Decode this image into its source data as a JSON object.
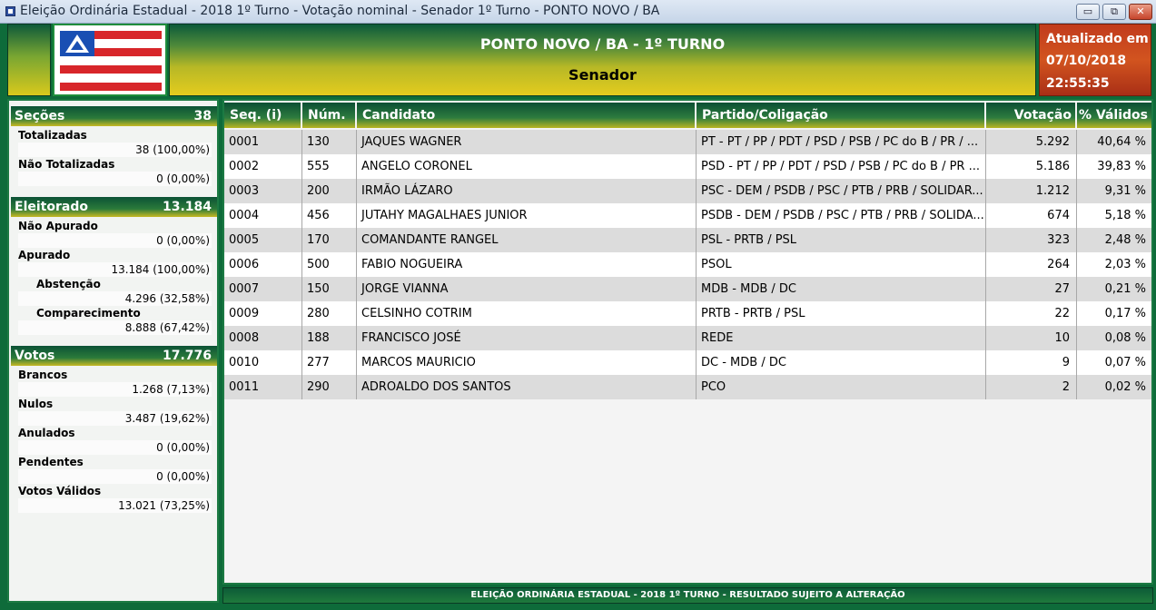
{
  "window": {
    "title": "Eleição Ordinária Estadual - 2018 1º Turno - Votação nominal - Senador 1º Turno - PONTO NOVO / BA",
    "minimize": "▭",
    "restore": "⧉",
    "close": "✕"
  },
  "header": {
    "location_round": "PONTO NOVO / BA - 1º TURNO",
    "office": "Senador",
    "updated_label": "Atualizado em",
    "updated_date": "07/10/2018",
    "updated_time": "22:55:35"
  },
  "summary": {
    "secoes": {
      "label": "Seções",
      "value": "38"
    },
    "totalizadas": {
      "label": "Totalizadas",
      "value": "38 (100,00%)"
    },
    "nao_totalizadas": {
      "label": "Não Totalizadas",
      "value": "0 (0,00%)"
    },
    "eleitorado": {
      "label": "Eleitorado",
      "value": "13.184"
    },
    "nao_apurado": {
      "label": "Não Apurado",
      "value": "0 (0,00%)"
    },
    "apurado": {
      "label": "Apurado",
      "value": "13.184 (100,00%)"
    },
    "abstencao": {
      "label": "Abstenção",
      "value": "4.296 (32,58%)"
    },
    "comparecimento": {
      "label": "Comparecimento",
      "value": "8.888 (67,42%)"
    },
    "votos": {
      "label": "Votos",
      "value": "17.776"
    },
    "brancos": {
      "label": "Brancos",
      "value": "1.268 (7,13%)"
    },
    "nulos": {
      "label": "Nulos",
      "value": "3.487 (19,62%)"
    },
    "anulados": {
      "label": "Anulados",
      "value": "0 (0,00%)"
    },
    "pendentes": {
      "label": "Pendentes",
      "value": "0 (0,00%)"
    },
    "votos_validos": {
      "label": "Votos Válidos",
      "value": "13.021 (73,25%)"
    }
  },
  "table": {
    "headers": [
      "Seq.   (i)",
      "Núm.",
      "Candidato",
      "Partido/Coligação",
      "Votação",
      "% Válidos"
    ],
    "rows": [
      [
        "0001",
        "130",
        "JAQUES WAGNER",
        "PT - PT / PP / PDT / PSD / PSB / PC do B / PR / ...",
        "5.292",
        "40,64 %"
      ],
      [
        "0002",
        "555",
        "ANGELO CORONEL",
        "PSD - PT / PP / PDT / PSD / PSB / PC do B / PR ...",
        "5.186",
        "39,83 %"
      ],
      [
        "0003",
        "200",
        "IRMÃO LÁZARO",
        "PSC - DEM / PSDB / PSC / PTB / PRB / SOLIDAR...",
        "1.212",
        "9,31 %"
      ],
      [
        "0004",
        "456",
        "JUTAHY MAGALHAES JUNIOR",
        "PSDB - DEM / PSDB / PSC / PTB / PRB / SOLIDA...",
        "674",
        "5,18 %"
      ],
      [
        "0005",
        "170",
        "COMANDANTE RANGEL",
        "PSL - PRTB / PSL",
        "323",
        "2,48 %"
      ],
      [
        "0006",
        "500",
        "FABIO NOGUEIRA",
        "PSOL",
        "264",
        "2,03 %"
      ],
      [
        "0007",
        "150",
        "JORGE VIANNA",
        "MDB - MDB / DC",
        "27",
        "0,21 %"
      ],
      [
        "0009",
        "280",
        "CELSINHO COTRIM",
        "PRTB - PRTB / PSL",
        "22",
        "0,17 %"
      ],
      [
        "0008",
        "188",
        "FRANCISCO JOSÉ",
        "REDE",
        "10",
        "0,08 %"
      ],
      [
        "0010",
        "277",
        "MARCOS MAURICIO",
        "DC - MDB / DC",
        "9",
        "0,07 %"
      ],
      [
        "0011",
        "290",
        "ADROALDO DOS SANTOS",
        "PCO",
        "2",
        "0,02 %"
      ]
    ]
  },
  "footer": {
    "text": "ELEIÇÃO ORDINÁRIA ESTADUAL - 2018 1º TURNO - RESULTADO SUJEITO A ALTERAÇÃO"
  },
  "colors": {
    "green_dark": "#0e6b3a",
    "gold": "#e4cc1e",
    "red_panel": "#c13b1d",
    "row_shade": "#dcdcdc"
  }
}
